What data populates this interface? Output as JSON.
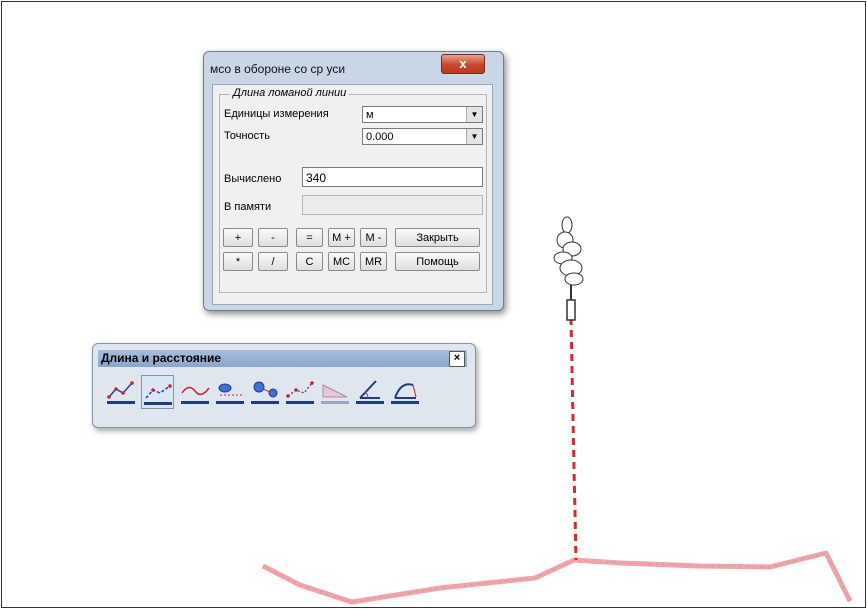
{
  "calculator": {
    "title": "мсо в обороне со ср уси",
    "close_label": "x",
    "group_title": "Длина ломаной линии",
    "units_label": "Единицы измерения",
    "units_value": "м",
    "precision_label": "Точность",
    "precision_value": "0.000",
    "computed_label": "Вычислено",
    "computed_value": "340",
    "memory_label": "В памяти",
    "memory_value": "",
    "buttons": {
      "plus": "+",
      "minus": "-",
      "equals": "=",
      "mplus": "M +",
      "mminus": "M -",
      "multiply": "*",
      "divide": "/",
      "clear": "C",
      "mc": "MC",
      "mr": "MR",
      "close": "Закрыть",
      "help": "Помощь"
    }
  },
  "toolbar": {
    "title": "Длина и расстояние",
    "close_label": "×",
    "tools": [
      {
        "icon": "polyline-length-icon"
      },
      {
        "icon": "polyline-length-selected-icon"
      },
      {
        "icon": "curve-length-icon"
      },
      {
        "icon": "object-distance-icon"
      },
      {
        "icon": "circle-distance-icon"
      },
      {
        "icon": "multi-point-distance-icon"
      },
      {
        "icon": "area-distance-icon"
      },
      {
        "icon": "angle-measure-icon"
      },
      {
        "icon": "curved-angle-icon"
      }
    ]
  },
  "colors": {
    "measure_line": "#e0262b",
    "terrain_line": "#f0a3a8",
    "dialog_frame": "#c9d6e6",
    "toolbar_header": "#9bb4d6"
  }
}
